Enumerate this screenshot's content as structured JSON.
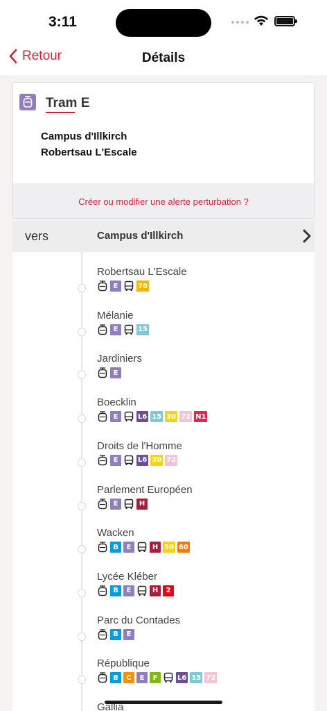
{
  "status_bar": {
    "time": "3:11"
  },
  "nav": {
    "back_label": "Retour",
    "title": "Détails"
  },
  "line": {
    "name": "Tram E",
    "color": "#9180b7",
    "terminus_1": "Campus d'Illkirch",
    "terminus_2": "Robertsau L'Escale",
    "alert_link": "Créer ou modifier une alerte perturbation ?"
  },
  "direction": {
    "prefix": "vers",
    "destination": "Campus d'Illkirch"
  },
  "stops": [
    {
      "name": "Robertsau L'Escale",
      "connections": [
        {
          "kind": "tram"
        },
        {
          "kind": "line",
          "label": "E",
          "bg": "#9180b7",
          "fg": "#ffffff"
        },
        {
          "kind": "bus"
        },
        {
          "kind": "line",
          "label": "70",
          "bg": "#f4b400",
          "fg": "#ffffff"
        }
      ]
    },
    {
      "name": "Mélanie",
      "connections": [
        {
          "kind": "tram"
        },
        {
          "kind": "line",
          "label": "E",
          "bg": "#9180b7",
          "fg": "#ffffff"
        },
        {
          "kind": "bus"
        },
        {
          "kind": "line",
          "label": "15",
          "bg": "#7ecad4",
          "fg": "#ffffff"
        }
      ]
    },
    {
      "name": "Jardiniers",
      "connections": [
        {
          "kind": "tram"
        },
        {
          "kind": "line",
          "label": "E",
          "bg": "#9180b7",
          "fg": "#ffffff"
        }
      ]
    },
    {
      "name": "Boecklin",
      "connections": [
        {
          "kind": "tram"
        },
        {
          "kind": "line",
          "label": "E",
          "bg": "#9180b7",
          "fg": "#ffffff"
        },
        {
          "kind": "bus"
        },
        {
          "kind": "line",
          "label": "L6",
          "bg": "#6d4d97",
          "fg": "#ffffff"
        },
        {
          "kind": "line",
          "label": "15",
          "bg": "#7ecad4",
          "fg": "#ffffff"
        },
        {
          "kind": "line",
          "label": "30",
          "bg": "#f5d40a",
          "fg": "#ffffff"
        },
        {
          "kind": "line",
          "label": "72",
          "bg": "#f3c4d5",
          "fg": "#ffffff"
        },
        {
          "kind": "line",
          "label": "N1",
          "bg": "#dd2b54",
          "fg": "#ffffff"
        }
      ]
    },
    {
      "name": "Droits de l'Homme",
      "connections": [
        {
          "kind": "tram"
        },
        {
          "kind": "line",
          "label": "E",
          "bg": "#9180b7",
          "fg": "#ffffff"
        },
        {
          "kind": "bus"
        },
        {
          "kind": "line",
          "label": "L6",
          "bg": "#6d4d97",
          "fg": "#ffffff"
        },
        {
          "kind": "line",
          "label": "30",
          "bg": "#f5d40a",
          "fg": "#ffffff"
        },
        {
          "kind": "line",
          "label": "72",
          "bg": "#f3c4d5",
          "fg": "#ffffff"
        }
      ]
    },
    {
      "name": "Parlement Européen",
      "connections": [
        {
          "kind": "tram"
        },
        {
          "kind": "line",
          "label": "E",
          "bg": "#9180b7",
          "fg": "#ffffff"
        },
        {
          "kind": "bus"
        },
        {
          "kind": "line",
          "label": "H",
          "bg": "#a51e3c",
          "fg": "#ffffff"
        }
      ]
    },
    {
      "name": "Wacken",
      "connections": [
        {
          "kind": "tram"
        },
        {
          "kind": "line",
          "label": "B",
          "bg": "#0a9bd8",
          "fg": "#ffffff"
        },
        {
          "kind": "line",
          "label": "E",
          "bg": "#9180b7",
          "fg": "#ffffff"
        },
        {
          "kind": "bus"
        },
        {
          "kind": "line",
          "label": "H",
          "bg": "#a51e3c",
          "fg": "#ffffff"
        },
        {
          "kind": "line",
          "label": "50",
          "bg": "#f5d40a",
          "fg": "#ffffff"
        },
        {
          "kind": "line",
          "label": "60",
          "bg": "#ee7d11",
          "fg": "#ffffff"
        }
      ]
    },
    {
      "name": "Lycée Kléber",
      "connections": [
        {
          "kind": "tram"
        },
        {
          "kind": "line",
          "label": "B",
          "bg": "#0a9bd8",
          "fg": "#ffffff"
        },
        {
          "kind": "line",
          "label": "E",
          "bg": "#9180b7",
          "fg": "#ffffff"
        },
        {
          "kind": "bus"
        },
        {
          "kind": "line",
          "label": "H",
          "bg": "#a51e3c",
          "fg": "#ffffff"
        },
        {
          "kind": "line",
          "label": "2",
          "bg": "#e30613",
          "fg": "#ffffff"
        }
      ]
    },
    {
      "name": "Parc du Contades",
      "connections": [
        {
          "kind": "tram"
        },
        {
          "kind": "line",
          "label": "B",
          "bg": "#0a9bd8",
          "fg": "#ffffff"
        },
        {
          "kind": "line",
          "label": "E",
          "bg": "#9180b7",
          "fg": "#ffffff"
        }
      ]
    },
    {
      "name": "République",
      "connections": [
        {
          "kind": "tram"
        },
        {
          "kind": "line",
          "label": "B",
          "bg": "#0a9bd8",
          "fg": "#ffffff"
        },
        {
          "kind": "line",
          "label": "C",
          "bg": "#f39200",
          "fg": "#ffffff"
        },
        {
          "kind": "line",
          "label": "E",
          "bg": "#9180b7",
          "fg": "#ffffff"
        },
        {
          "kind": "line",
          "label": "F",
          "bg": "#83b81a",
          "fg": "#ffffff"
        },
        {
          "kind": "bus"
        },
        {
          "kind": "line",
          "label": "L6",
          "bg": "#6d4d97",
          "fg": "#ffffff"
        },
        {
          "kind": "line",
          "label": "15",
          "bg": "#7ecad4",
          "fg": "#ffffff"
        },
        {
          "kind": "line",
          "label": "72",
          "bg": "#f3c4d5",
          "fg": "#ffffff"
        }
      ]
    },
    {
      "name": "Gallia",
      "connections": []
    }
  ]
}
